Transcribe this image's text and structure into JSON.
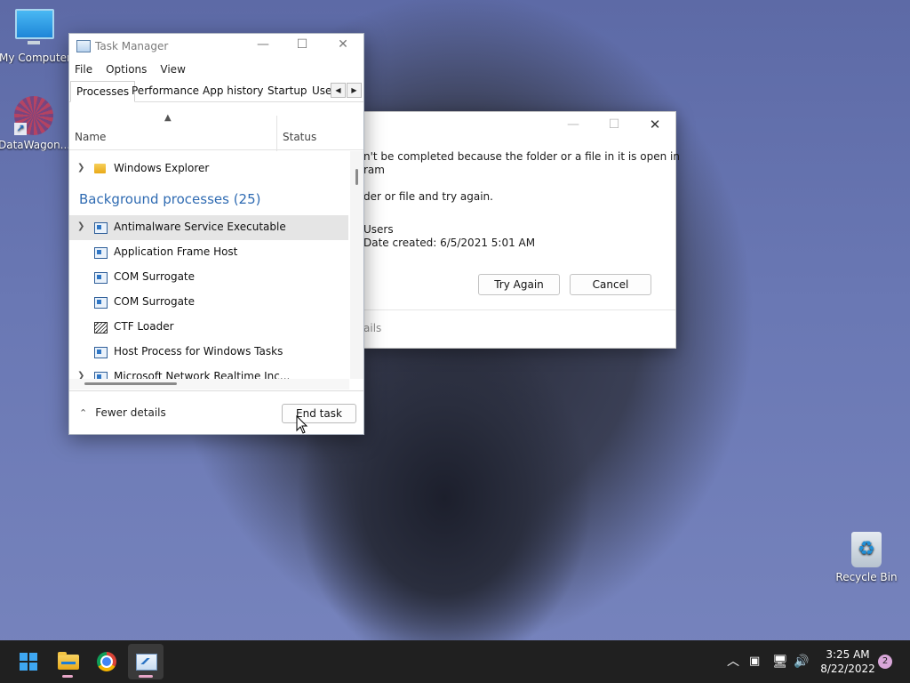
{
  "desktop": {
    "icons": [
      {
        "label": "My Computer"
      },
      {
        "label": "DataWagon..."
      },
      {
        "label": "Recycle Bin"
      }
    ]
  },
  "dialog": {
    "line1": "n't be completed because the folder or a file in it is open in",
    "line2": "ram",
    "line3": "der or file and try again.",
    "item_name": "Users",
    "date_created": "Date created: 6/5/2021 5:01 AM",
    "try_again_label": "Try Again",
    "cancel_label": "Cancel",
    "details_label": "ails"
  },
  "task_manager": {
    "title": "Task Manager",
    "menu": [
      "File",
      "Options",
      "View"
    ],
    "tabs": [
      "Processes",
      "Performance",
      "App history",
      "Startup",
      "Use"
    ],
    "columns": {
      "name": "Name",
      "status": "Status"
    },
    "apps": [
      {
        "name": "Windows Explorer"
      }
    ],
    "group_label": "Background processes (25)",
    "background": [
      {
        "name": "Antimalware Service Executable"
      },
      {
        "name": "Application Frame Host"
      },
      {
        "name": "COM Surrogate"
      },
      {
        "name": "COM Surrogate"
      },
      {
        "name": "CTF Loader"
      },
      {
        "name": "Host Process for Windows Tasks"
      },
      {
        "name": "Microsoft Network Realtime Inc..."
      }
    ],
    "fewer_details_label": "Fewer details",
    "end_task_label": "End task"
  },
  "taskbar": {
    "time": "3:25 AM",
    "date": "8/22/2022",
    "notification_count": "2"
  },
  "colors": {
    "accent": "#2f6bb2",
    "taskbar": "#202020"
  }
}
